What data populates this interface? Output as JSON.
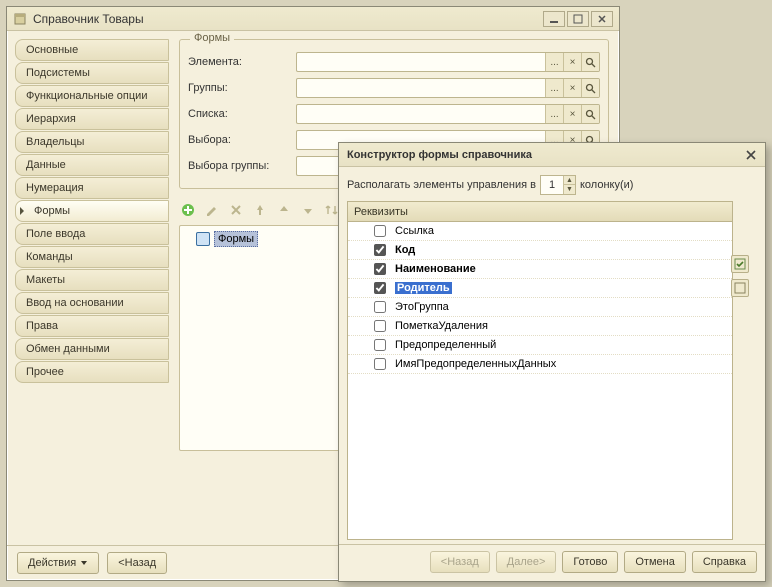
{
  "window": {
    "title": "Справочник Товары"
  },
  "sidebar": {
    "items": [
      "Основные",
      "Подсистемы",
      "Функциональные опции",
      "Иерархия",
      "Владельцы",
      "Данные",
      "Нумерация",
      "Формы",
      "Поле ввода",
      "Команды",
      "Макеты",
      "Ввод на основании",
      "Права",
      "Обмен данными",
      "Прочее"
    ],
    "active_index": 7
  },
  "group_frame": {
    "title": "Формы",
    "rows": [
      "Элемента:",
      "Группы:",
      "Списка:",
      "Выбора:",
      "Выбора группы:"
    ]
  },
  "mini_btn": {
    "dots": "...",
    "clear": "×",
    "search": "🔍"
  },
  "tree": {
    "root": "Формы"
  },
  "bottom": {
    "actions": "Действия",
    "back": "<Назад"
  },
  "dialog": {
    "title": "Конструктор формы справочника",
    "layout_prefix": "Располагать элементы управления в",
    "layout_value": "1",
    "layout_suffix": "колонку(и)",
    "req_header": "Реквизиты",
    "items": [
      {
        "label": "Ссылка",
        "checked": false,
        "bold": false,
        "sel": false
      },
      {
        "label": "Код",
        "checked": true,
        "bold": true,
        "sel": false
      },
      {
        "label": "Наименование",
        "checked": true,
        "bold": true,
        "sel": false
      },
      {
        "label": "Родитель",
        "checked": true,
        "bold": true,
        "sel": true
      },
      {
        "label": "ЭтоГруппа",
        "checked": false,
        "bold": false,
        "sel": false
      },
      {
        "label": "ПометкаУдаления",
        "checked": false,
        "bold": false,
        "sel": false
      },
      {
        "label": "Предопределенный",
        "checked": false,
        "bold": false,
        "sel": false
      },
      {
        "label": "ИмяПредопределенныхДанных",
        "checked": false,
        "bold": false,
        "sel": false
      }
    ],
    "buttons": {
      "back": "<Назад",
      "next": "Далее>",
      "done": "Готово",
      "cancel": "Отмена",
      "help": "Справка"
    }
  }
}
